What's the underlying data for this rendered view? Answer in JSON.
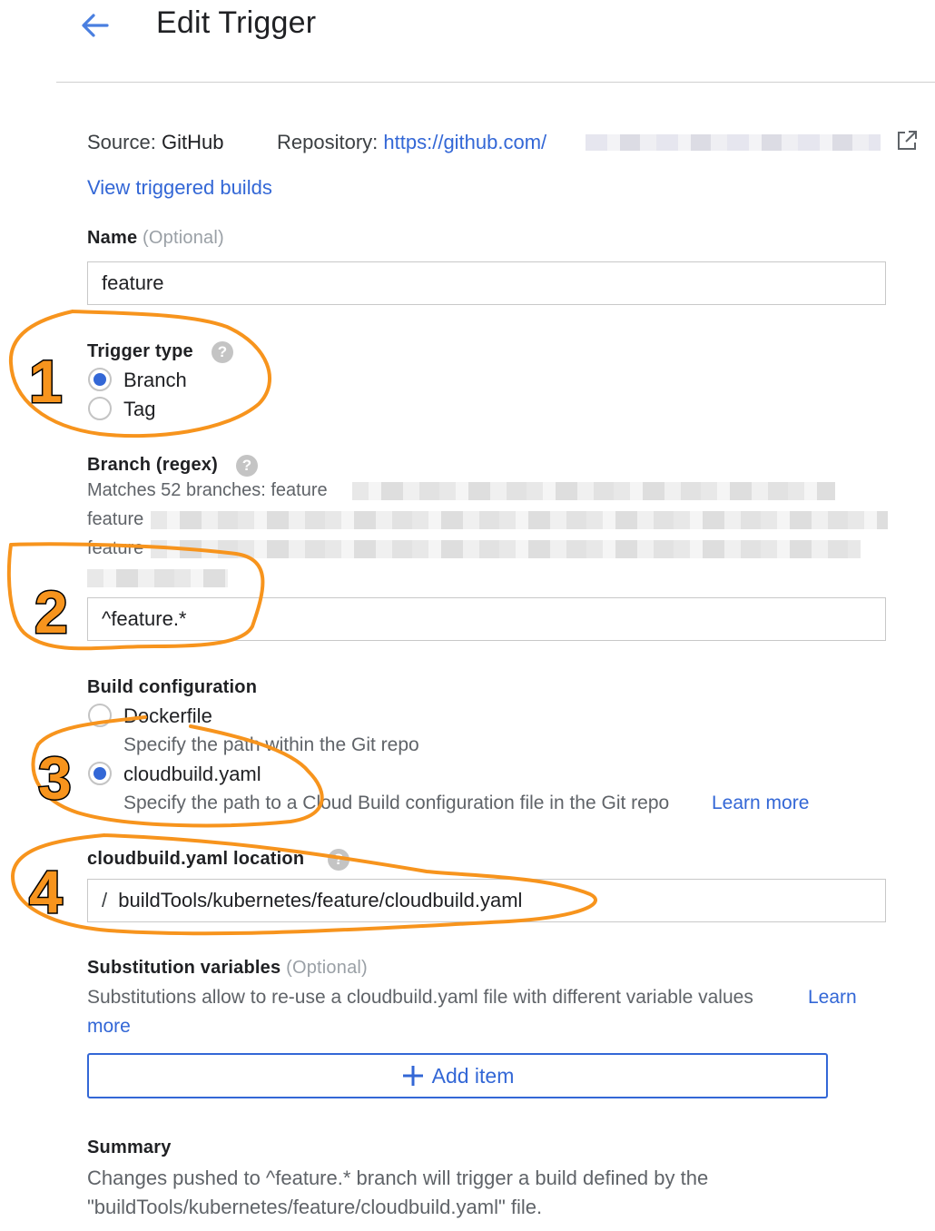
{
  "header": {
    "title": "Edit Trigger",
    "back_icon": "arrow-back-icon"
  },
  "source": {
    "source_label": "Source:",
    "source_value": "GitHub",
    "repo_label": "Repository:",
    "repo_url": "https://github.com/",
    "external_icon": "open-in-new-icon",
    "view_builds_link": "View triggered builds"
  },
  "name_field": {
    "label": "Name",
    "optional": "(Optional)",
    "value": "feature"
  },
  "trigger_type": {
    "label": "Trigger type",
    "options": [
      {
        "label": "Branch",
        "selected": true
      },
      {
        "label": "Tag",
        "selected": false
      }
    ]
  },
  "branch": {
    "label": "Branch (regex)",
    "matches_text": "Matches 52 branches: feature",
    "line2_prefix": "feature",
    "line3_prefix": "feature",
    "value": "^feature.*"
  },
  "build_config": {
    "label": "Build configuration",
    "options": [
      {
        "label": "Dockerfile",
        "desc": "Specify the path within the Git repo",
        "selected": false
      },
      {
        "label": "cloudbuild.yaml",
        "desc": "Specify the path to a Cloud Build configuration file in the Git repo",
        "selected": true
      }
    ],
    "learn_more": "Learn more"
  },
  "cloudbuild_location": {
    "label": "cloudbuild.yaml location",
    "prefix": "/",
    "value": "buildTools/kubernetes/feature/cloudbuild.yaml"
  },
  "substitutions": {
    "label": "Substitution variables",
    "optional": "(Optional)",
    "desc": "Substitutions allow to re-use a cloudbuild.yaml file with different variable values",
    "learn": "Learn",
    "more": "more",
    "add_item": "Add item"
  },
  "summary": {
    "label": "Summary",
    "line1": "Changes pushed to ^feature.* branch will trigger a build defined by the",
    "line2": "\"buildTools/kubernetes/feature/cloudbuild.yaml\" file."
  },
  "annotations": {
    "numbers": [
      "1",
      "2",
      "3",
      "4"
    ],
    "color": "#f7941d"
  },
  "colors": {
    "accent": "#3367d6",
    "annotation": "#f7941d"
  }
}
